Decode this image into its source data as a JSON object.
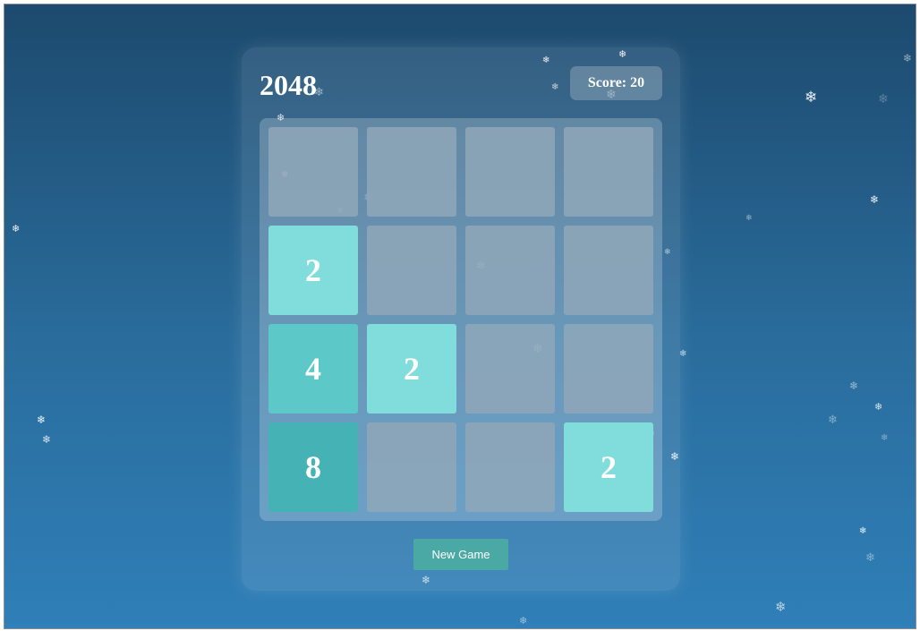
{
  "game": {
    "title": "2048",
    "score_text": "Score: 20",
    "new_game_label": "New Game"
  },
  "board": {
    "rows": [
      [
        "",
        "",
        "",
        ""
      ],
      [
        "2",
        "",
        "",
        ""
      ],
      [
        "4",
        "2",
        "",
        ""
      ],
      [
        "8",
        "",
        "",
        "2"
      ]
    ]
  },
  "colors": {
    "empty_tile": "#8fa7b8",
    "tile_2": "#81dcdc",
    "tile_4": "#5cc8c8",
    "tile_8": "#45b3b6",
    "new_game_button": "#4aa9a4"
  },
  "decoration": {
    "snowflake_icon": "snowflake-icon"
  }
}
